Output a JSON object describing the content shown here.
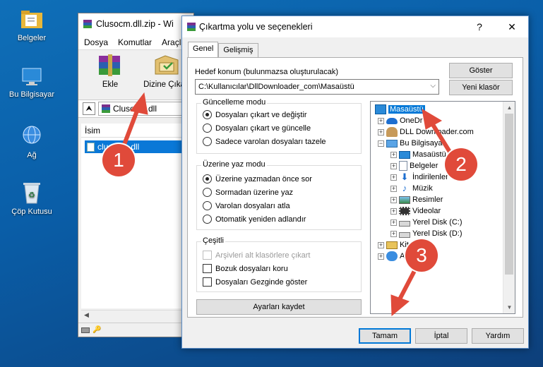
{
  "desktop": {
    "icons": [
      {
        "label": "Belgeler",
        "icon": "folder-icon"
      },
      {
        "label": "Bu Bilgisayar",
        "icon": "computer-icon"
      },
      {
        "label": "Ağ",
        "icon": "network-icon"
      },
      {
        "label": "Çöp Kutusu",
        "icon": "recycle-bin-icon"
      }
    ]
  },
  "rar_window": {
    "title": "Clusocm.dll.zip - Wi",
    "menu": [
      "Dosya",
      "Komutlar",
      "Araçla"
    ],
    "toolbar": [
      {
        "label": "Ekle",
        "icon": "winrar-books-icon"
      },
      {
        "label": "Dizine Çıkart",
        "icon": "extract-folder-icon"
      }
    ],
    "address": "Clusocm.dll",
    "list_header": "İsim",
    "file": "clusocm.dll"
  },
  "dialog": {
    "title": "Çıkartma yolu ve seçenekleri",
    "help_btn": "?",
    "close_btn": "✕",
    "tabs": [
      "Genel",
      "Gelişmiş"
    ],
    "dest_label": "Hedef konum (bulunmazsa oluşturulacak)",
    "dest_value": "C:\\Kullanıcılar\\DllDownloader_com\\Masaüstü",
    "show_btn": "Göster",
    "new_folder_btn": "Yeni klasör",
    "update_mode": {
      "title": "Güncelleme modu",
      "options": [
        "Dosyaları çıkart ve değiştir",
        "Dosyaları çıkart ve güncelle",
        "Sadece varolan dosyaları tazele"
      ],
      "selected": 0
    },
    "overwrite_mode": {
      "title": "Üzerine yaz modu",
      "options": [
        "Üzerine yazmadan önce sor",
        "Sormadan üzerine yaz",
        "Varolan dosyaları atla",
        "Otomatik yeniden adlandır"
      ],
      "selected": 0
    },
    "misc": {
      "title": "Çeşitli",
      "options": [
        "Arşivleri alt klasörlere çıkart",
        "Bozuk dosyaları koru",
        "Dosyaları Gezginde göster"
      ]
    },
    "save_btn": "Ayarları kaydet",
    "tree": [
      {
        "label": "Masaüstü",
        "selected": true,
        "icon": "desktop-icon"
      },
      {
        "label": "OneDr",
        "icon": "onedrive-icon"
      },
      {
        "label": "DLL Downloader.com",
        "icon": "user-icon"
      },
      {
        "label": "Bu Bilgisaya",
        "icon": "computer-icon"
      },
      {
        "label": "Masaüstü",
        "icon": "desktop-icon"
      },
      {
        "label": "Belgeler",
        "icon": "documents-icon"
      },
      {
        "label": "İndirilenler",
        "icon": "downloads-icon"
      },
      {
        "label": "Müzik",
        "icon": "music-icon"
      },
      {
        "label": "Resimler",
        "icon": "pictures-icon"
      },
      {
        "label": "Videolar",
        "icon": "videos-icon"
      },
      {
        "label": "Yerel Disk (C:)",
        "icon": "drive-icon"
      },
      {
        "label": "Yerel Disk (D:)",
        "icon": "drive-icon"
      },
      {
        "label": "Kitapl",
        "icon": "libraries-icon"
      },
      {
        "label": "Ağ",
        "icon": "network-icon"
      }
    ],
    "ok_btn": "Tamam",
    "cancel_btn": "İptal",
    "help_btn2": "Yardım"
  },
  "markers": [
    "1",
    "2",
    "3"
  ],
  "colors": {
    "marker": "#e04a3a",
    "selection": "#0078d7"
  }
}
